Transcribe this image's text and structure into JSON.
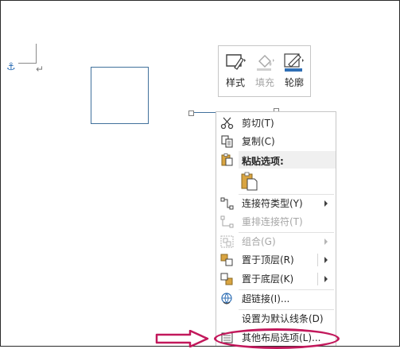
{
  "document": {
    "anchor_symbol": "⚓",
    "paragraph_mark": "↵"
  },
  "mini_toolbar": {
    "style_label": "样式",
    "fill_label": "填充",
    "outline_label": "轮廓",
    "accent_color": "#2f6fb5"
  },
  "context_menu": {
    "cut": "剪切(T)",
    "copy": "复制(C)",
    "paste_options_header": "粘贴选项:",
    "connector_type": "连接符类型(Y)",
    "reroute_connectors": "重排连接符(T)",
    "group": "组合(G)",
    "bring_to_front": "置于顶层(R)",
    "send_to_back": "置于底层(K)",
    "hyperlink": "超链接(I)...",
    "set_default_line": "设置为默认线条(D)",
    "more_layout_options": "其他布局选项(L)..."
  },
  "annotation": {
    "highlight_color": "#c2185b"
  }
}
